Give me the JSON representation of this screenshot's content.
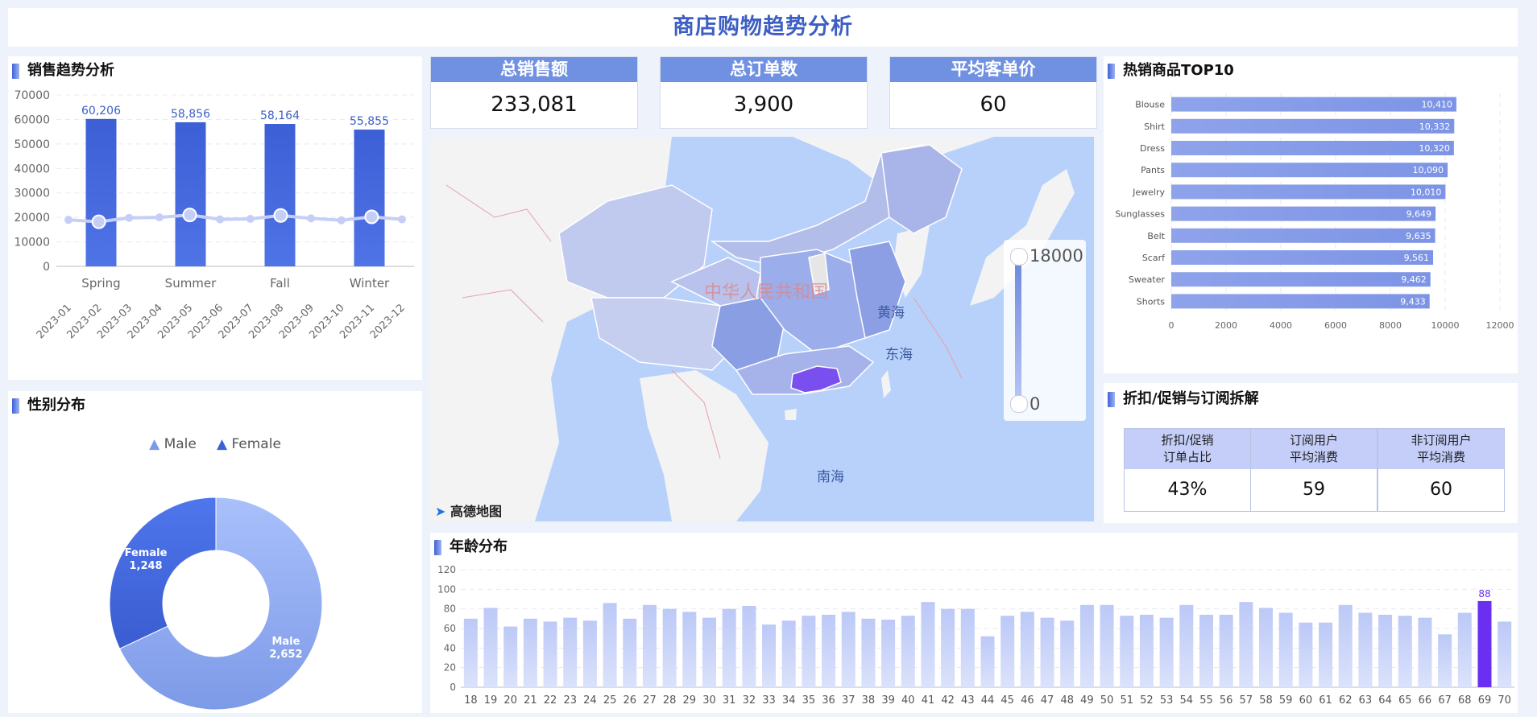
{
  "header": {
    "title": "商店购物趋势分析"
  },
  "sales_trend": {
    "title": "销售趋势分析",
    "chart_data": {
      "type": "bar",
      "categories": [
        "Spring",
        "Summer",
        "Fall",
        "Winter"
      ],
      "values": [
        60206,
        58856,
        58164,
        55855
      ],
      "value_labels": [
        "60,206",
        "58,856",
        "58,164",
        "55,855"
      ],
      "ylim": [
        0,
        70000
      ],
      "yticks": [
        "0",
        "10000",
        "20000",
        "30000",
        "40000",
        "50000",
        "60000",
        "70000"
      ],
      "line_series": {
        "x": [
          "2023-01",
          "2023-02",
          "2023-03",
          "2023-04",
          "2023-05",
          "2023-06",
          "2023-07",
          "2023-08",
          "2023-09",
          "2023-10",
          "2023-11",
          "2023-12"
        ],
        "values": [
          19000,
          18200,
          19800,
          20000,
          21000,
          19200,
          19400,
          20800,
          19600,
          18800,
          20200,
          19200
        ]
      },
      "grid": true
    }
  },
  "kpis": [
    {
      "label": "总销售额",
      "value": "233,081"
    },
    {
      "label": "总订单数",
      "value": "3,900"
    },
    {
      "label": "平均客单价",
      "value": "60"
    }
  ],
  "map": {
    "visual_map": {
      "max": "18000",
      "min": "0"
    },
    "labels": {
      "country": "中华人民共和国",
      "yellow_sea": "黄海",
      "east_sea": "东海",
      "south_sea": "南海"
    },
    "brand": "高德地图",
    "colors": {
      "water": "#b7d1fb",
      "highlight": "#7a4ff0",
      "province": "#8ca0e6",
      "land": "#f3f3f3"
    }
  },
  "top_products": {
    "title": "热销商品TOP10",
    "chart_data": {
      "type": "bar",
      "orientation": "horizontal",
      "categories": [
        "Blouse",
        "Shirt",
        "Dress",
        "Pants",
        "Jewelry",
        "Sunglasses",
        "Belt",
        "Scarf",
        "Sweater",
        "Shorts"
      ],
      "values": [
        10410,
        10332,
        10320,
        10090,
        10010,
        9649,
        9635,
        9561,
        9462,
        9433
      ],
      "value_labels": [
        "10,410",
        "10,332",
        "10,320",
        "10,090",
        "10,010",
        "9,649",
        "9,635",
        "9,561",
        "9,462",
        "9,433"
      ],
      "xlim": [
        0,
        12000
      ],
      "xticks": [
        "0",
        "2000",
        "4000",
        "6000",
        "8000",
        "10000",
        "12000"
      ]
    }
  },
  "promo": {
    "title": "折扣/促销与订阅拆解",
    "boxes": [
      {
        "line1": "折扣/促销",
        "line2": "订单占比",
        "value": "43%"
      },
      {
        "line1": "订阅用户",
        "line2": "平均消费",
        "value": "59"
      },
      {
        "line1": "非订阅用户",
        "line2": "平均消费",
        "value": "60"
      }
    ]
  },
  "gender": {
    "title": "性别分布",
    "chart_data": {
      "type": "pie",
      "labels": [
        "Male",
        "Female"
      ],
      "values": [
        2652,
        1248
      ],
      "value_labels": [
        "2,652",
        "1,248"
      ],
      "colors": [
        "#7d9ae8",
        "#3d62d6"
      ]
    }
  },
  "age": {
    "title": "年龄分布",
    "chart_data": {
      "type": "bar",
      "categories": [
        "18",
        "19",
        "20",
        "21",
        "22",
        "23",
        "24",
        "25",
        "26",
        "27",
        "28",
        "29",
        "30",
        "31",
        "32",
        "33",
        "34",
        "35",
        "36",
        "37",
        "38",
        "39",
        "40",
        "41",
        "42",
        "43",
        "44",
        "45",
        "46",
        "47",
        "48",
        "49",
        "50",
        "51",
        "52",
        "53",
        "54",
        "55",
        "56",
        "57",
        "58",
        "59",
        "60",
        "61",
        "62",
        "63",
        "64",
        "65",
        "66",
        "67",
        "68",
        "69",
        "70"
      ],
      "values": [
        70,
        81,
        62,
        70,
        67,
        71,
        68,
        86,
        70,
        84,
        80,
        77,
        71,
        80,
        83,
        64,
        68,
        73,
        74,
        77,
        70,
        69,
        73,
        87,
        80,
        80,
        52,
        73,
        77,
        71,
        68,
        84,
        84,
        73,
        74,
        71,
        84,
        74,
        74,
        87,
        81,
        76,
        66,
        66,
        84,
        76,
        74,
        73,
        71,
        54,
        76,
        88,
        67
      ],
      "highlight": {
        "category": "69",
        "label": "88",
        "color": "#6a2ff0"
      },
      "ylim": [
        0,
        120
      ],
      "yticks": [
        "0",
        "20",
        "40",
        "60",
        "80",
        "100",
        "120"
      ]
    }
  }
}
